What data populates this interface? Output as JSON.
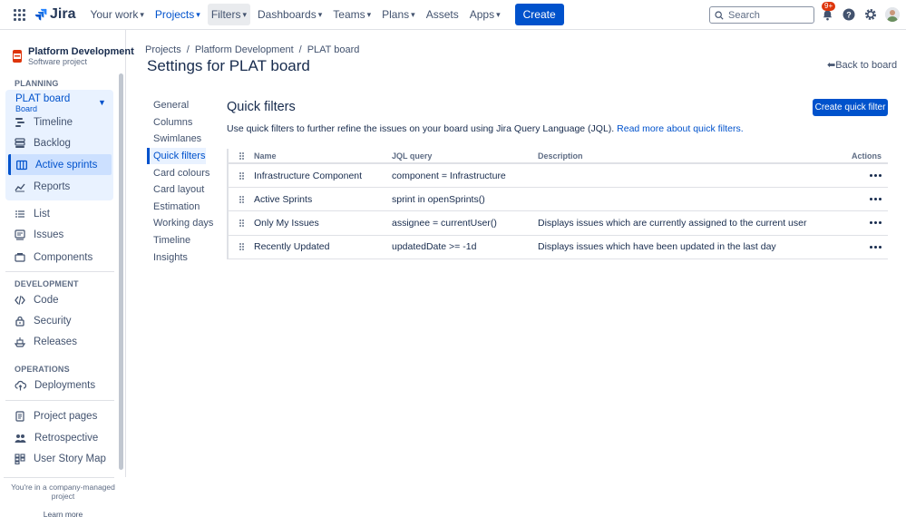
{
  "topnav": {
    "logo": "Jira",
    "items": [
      {
        "label": "Your work",
        "dropdown": true
      },
      {
        "label": "Projects",
        "dropdown": true
      },
      {
        "label": "Filters",
        "dropdown": true
      },
      {
        "label": "Dashboards",
        "dropdown": true
      },
      {
        "label": "Teams",
        "dropdown": true
      },
      {
        "label": "Plans",
        "dropdown": true
      },
      {
        "label": "Assets",
        "dropdown": false
      },
      {
        "label": "Apps",
        "dropdown": true
      }
    ],
    "create_label": "Create",
    "search_placeholder": "Search",
    "notifications_badge": "9+"
  },
  "sidebar": {
    "project_name": "Platform Development",
    "project_type": "Software project",
    "planning_label": "PLANNING",
    "board_name": "PLAT board",
    "board_sub": "Board",
    "planning_items": [
      "Timeline",
      "Backlog",
      "Active sprints",
      "Reports"
    ],
    "other_items": [
      "List",
      "Issues",
      "Components"
    ],
    "development_label": "DEVELOPMENT",
    "development_items": [
      "Code",
      "Security",
      "Releases"
    ],
    "operations_label": "OPERATIONS",
    "operations_items": [
      "Deployments"
    ],
    "extra_items": [
      "Project pages",
      "Retrospective",
      "User Story Map"
    ],
    "footer_text": "You're in a company-managed project",
    "learn_more": "Learn more"
  },
  "main": {
    "breadcrumb": [
      "Projects",
      "Platform Development",
      "PLAT board"
    ],
    "title": "Settings for PLAT board",
    "back_label": "Back to board",
    "settings_nav": [
      "General",
      "Columns",
      "Swimlanes",
      "Quick filters",
      "Card colours",
      "Card layout",
      "Estimation",
      "Working days",
      "Timeline",
      "Insights"
    ],
    "active_nav": "Quick filters",
    "section_title": "Quick filters",
    "description": "Use quick filters to further refine the issues on your board using Jira Query Language (JQL).",
    "description_link": "Read more about quick filters.",
    "create_button": "Create quick filter",
    "columns": {
      "name": "Name",
      "jql": "JQL query",
      "description": "Description",
      "actions": "Actions"
    },
    "rows": [
      {
        "name": "Infrastructure Component",
        "jql": "component = Infrastructure",
        "description": ""
      },
      {
        "name": "Active Sprints",
        "jql": "sprint in openSprints()",
        "description": ""
      },
      {
        "name": "Only My Issues",
        "jql": "assignee = currentUser()",
        "description": "Displays issues which are currently assigned to the current user"
      },
      {
        "name": "Recently Updated",
        "jql": "updatedDate >= -1d",
        "description": "Displays issues which have been updated in the last day"
      }
    ]
  },
  "colors": {
    "brand": "#0052cc",
    "text": "#172b4d",
    "subtle": "#42526e",
    "selected_bg": "#e9f2ff",
    "badge": "#de350b"
  }
}
